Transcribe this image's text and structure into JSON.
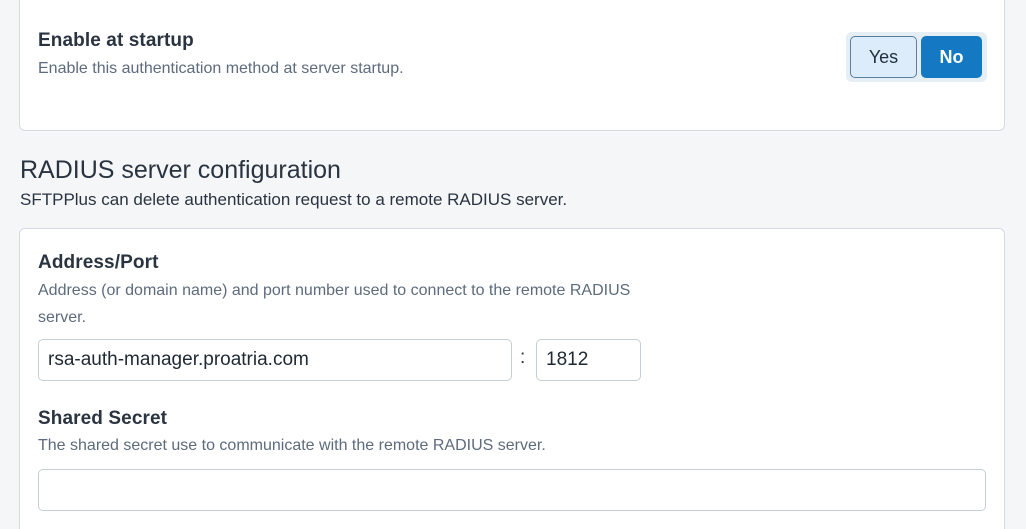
{
  "startup": {
    "title": "Enable at startup",
    "description": "Enable this authentication method at server startup.",
    "yes_label": "Yes",
    "no_label": "No",
    "selected": "No"
  },
  "radius_section": {
    "title": "RADIUS server configuration",
    "description": "SFTPPlus can delete authentication request to a remote RADIUS server."
  },
  "address_port": {
    "title": "Address/Port",
    "description_line1": "Address (or domain name) and port number used to connect to the remote RADIUS",
    "description_line2": "server.",
    "address_value": "rsa-auth-manager.proatria.com",
    "separator": ":",
    "port_value": "1812"
  },
  "shared_secret": {
    "title": "Shared Secret",
    "description": "The shared secret use to communicate with the remote RADIUS server.",
    "value": ""
  },
  "colors": {
    "accent": "#1478c2",
    "background": "#f4f6f8",
    "card": "#ffffff"
  }
}
